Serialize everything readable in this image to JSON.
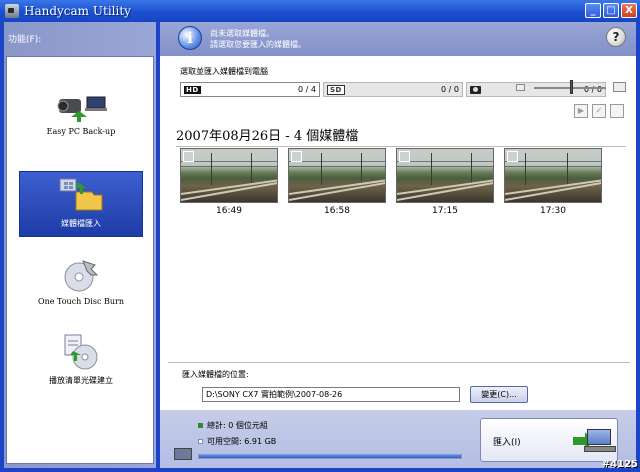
{
  "window": {
    "title": "Handycam Utility"
  },
  "window_controls": {
    "minimize": "_",
    "maximize": "□",
    "close": "X"
  },
  "sidebar": {
    "header": "功能(F):",
    "items": [
      {
        "label": "Easy PC Back-up",
        "selected": false
      },
      {
        "label": "媒體檔匯入",
        "selected": true
      },
      {
        "label": "One Touch Disc Burn",
        "selected": false
      },
      {
        "label": "播放清單光碟建立",
        "selected": false
      }
    ]
  },
  "message": {
    "line1": "尚未選取媒體檔。",
    "line2": "請選取您要匯入的媒體檔。",
    "help": "?"
  },
  "selection": {
    "title": "選取並匯入媒體檔到電腦",
    "filters": [
      {
        "badge": "HD",
        "count": "0 / 4"
      },
      {
        "badge": "SD",
        "count": "0 / 0"
      },
      {
        "badge": "",
        "count": "0 / 0",
        "icon": "camera-icon"
      }
    ],
    "zoom_level": 0.5
  },
  "toolbar": {
    "play": "▶",
    "check": "✓",
    "uncheck": ""
  },
  "group": {
    "date": "2007年08月26日",
    "separator": " - ",
    "count_label": "4 個媒體檔"
  },
  "thumbnails": [
    {
      "time": "16:49"
    },
    {
      "time": "16:58"
    },
    {
      "time": "17:15"
    },
    {
      "time": "17:30"
    }
  ],
  "destination": {
    "label": "匯入媒體檔的位置:",
    "path": "D:\\SONY CX7 實拍範例\\2007-08-26",
    "change_label": "變更(C)..."
  },
  "status": {
    "total": "總計: 0 個位元組",
    "free": "可用空間: 6.91 GB",
    "import_label": "匯入(I)"
  },
  "watermark": "#4125",
  "colors": {
    "title_bar": "#1b4fd0",
    "selected_item": "#2a4bbd",
    "panel": "#9aa6d6"
  }
}
